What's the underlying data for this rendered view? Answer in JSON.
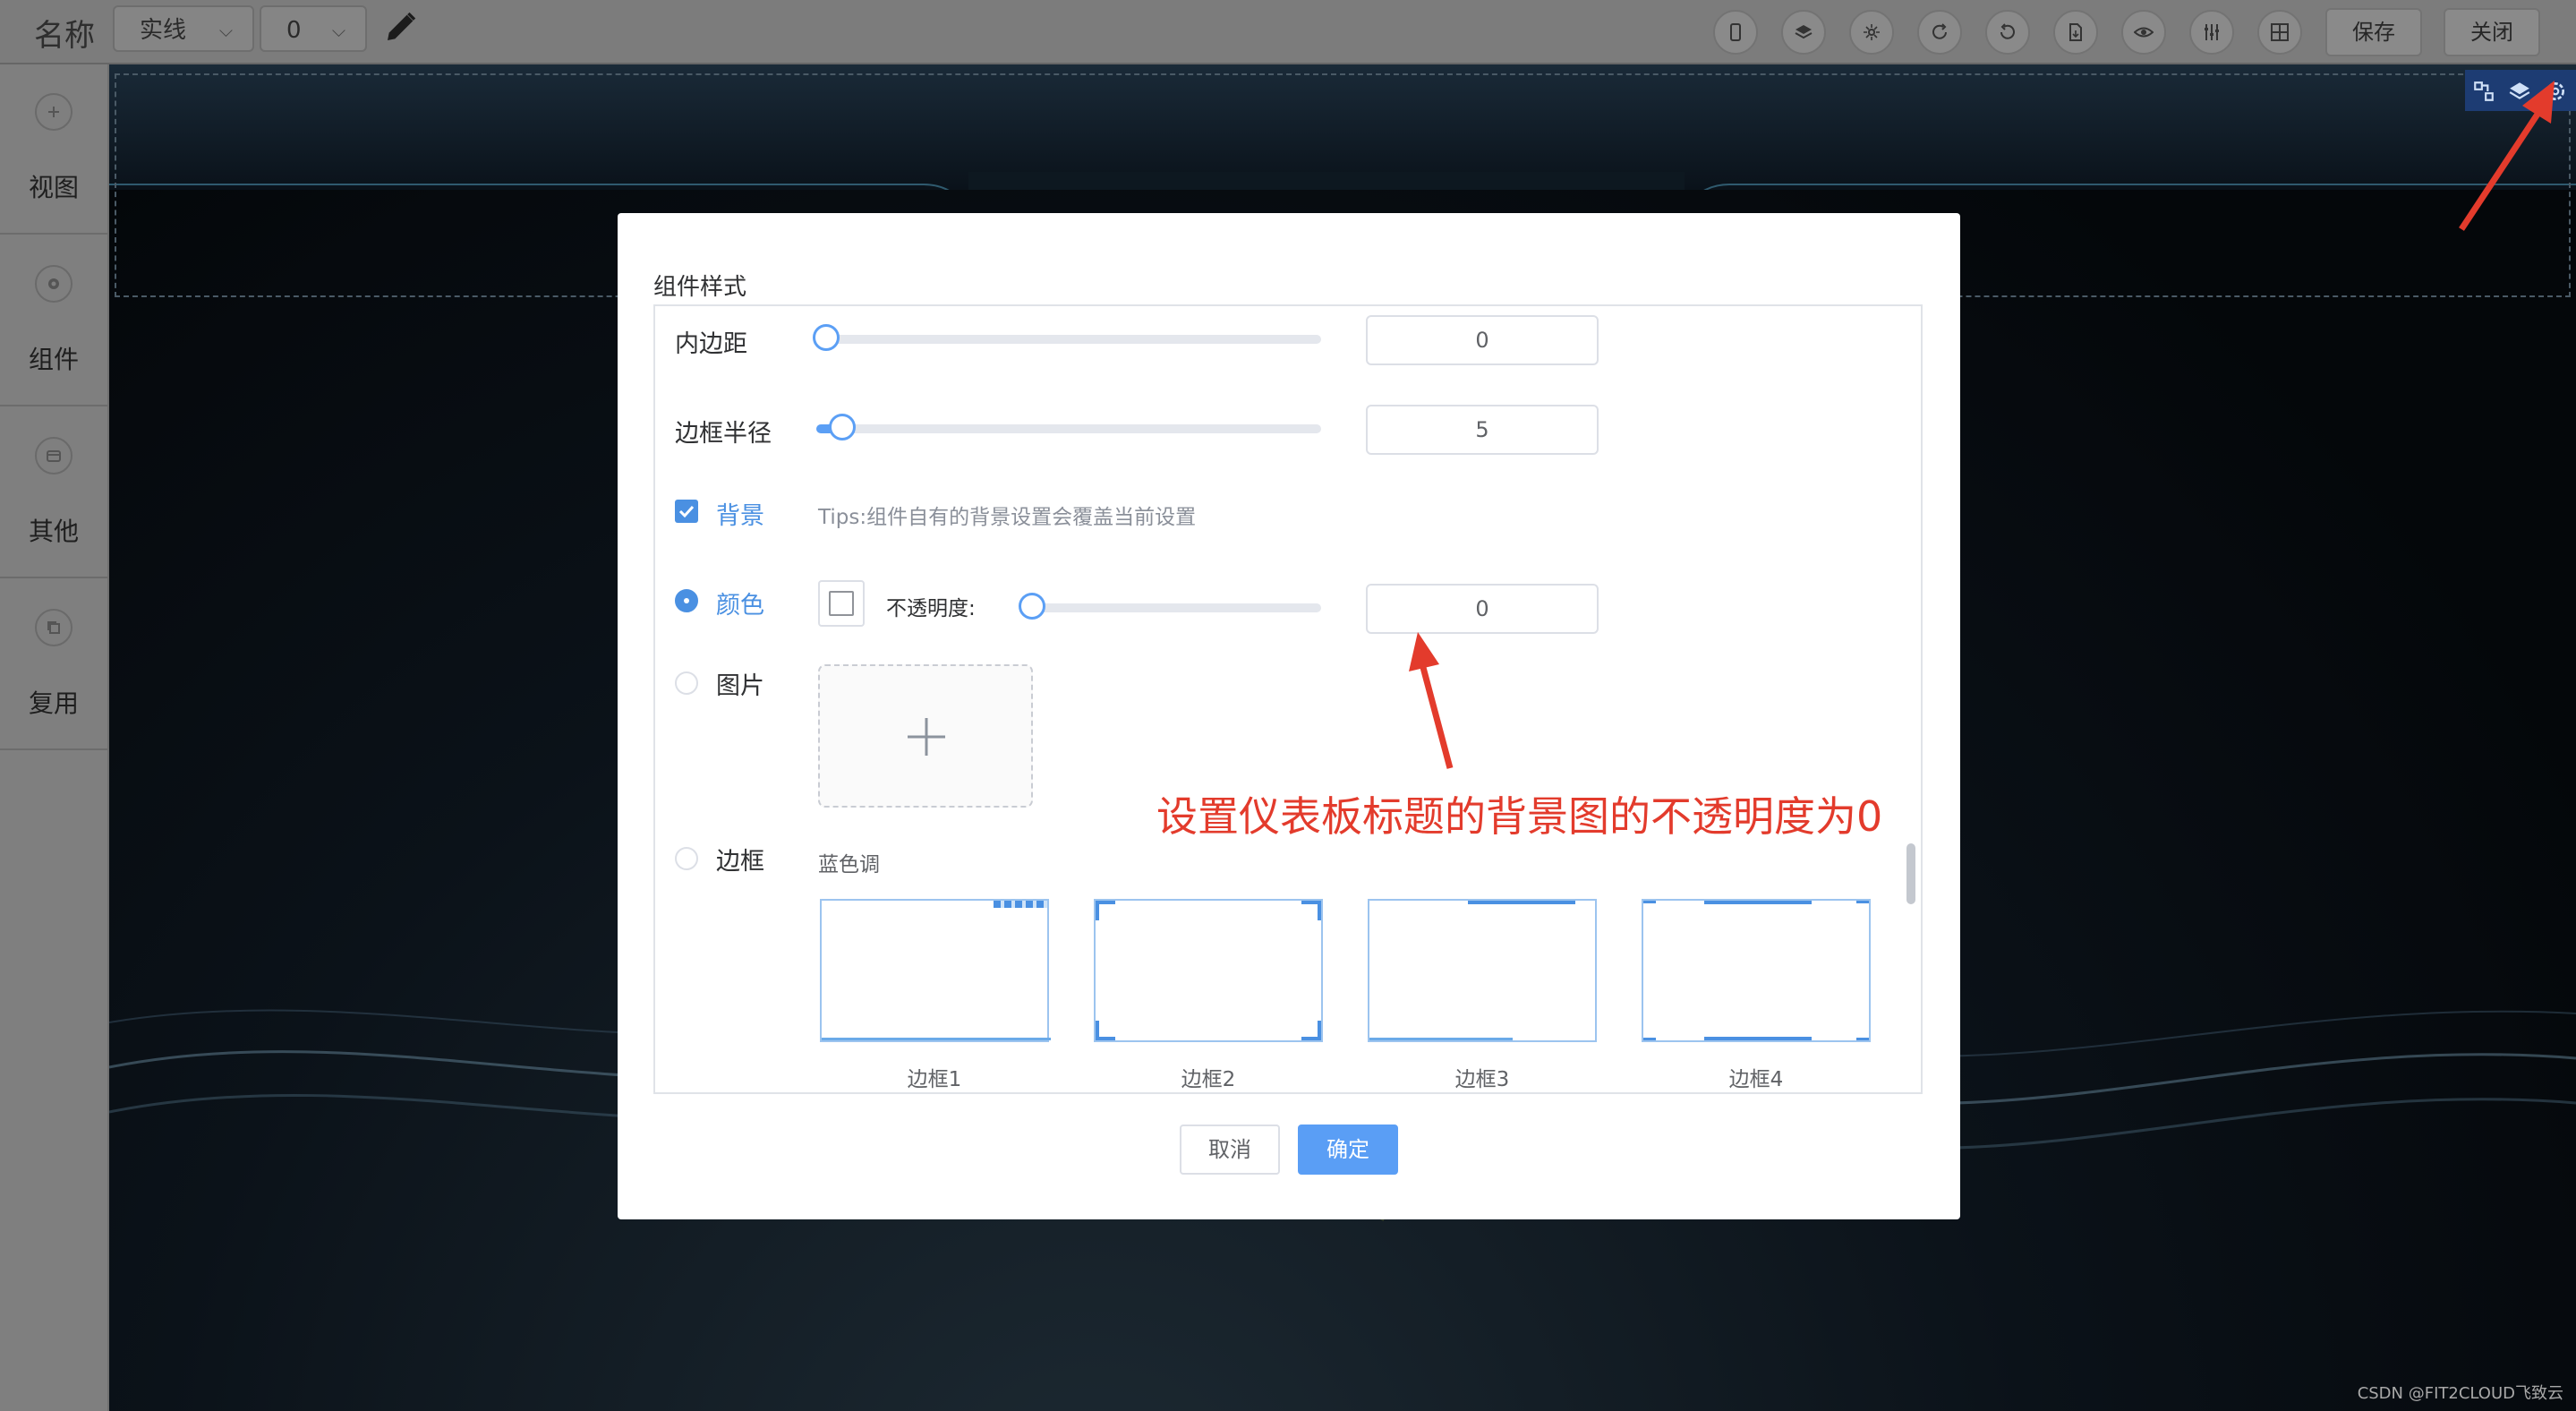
{
  "toolbar": {
    "name_label": "名称",
    "line_style": "实线",
    "line_width": "0",
    "icons": [
      "mobile-icon",
      "layers-icon",
      "magic-icon",
      "refresh-icon",
      "undo-icon",
      "export-icon",
      "preview-icon",
      "settings-sliders-icon",
      "grid-icon"
    ],
    "save_label": "保存",
    "close_label": "关闭"
  },
  "sidebar": {
    "items": [
      {
        "label": "视图",
        "icon": "plus-circle-icon"
      },
      {
        "label": "组件",
        "icon": "gear-icon"
      },
      {
        "label": "其他",
        "icon": "box-icon"
      },
      {
        "label": "复用",
        "icon": "copy-icon"
      }
    ]
  },
  "dialog": {
    "title": "组件样式",
    "padding": {
      "label": "内边距",
      "value": "0",
      "slider_fraction": 0.0
    },
    "radius": {
      "label": "边框半径",
      "value": "5",
      "slider_fraction": 0.05
    },
    "background": {
      "label": "背景",
      "checked": true,
      "tips": "Tips:组件自有的背景设置会覆盖当前设置"
    },
    "color": {
      "label": "颜色",
      "selected": true,
      "opacity_label": "不透明度:",
      "opacity_value": "0",
      "slider_fraction": 0.0
    },
    "image": {
      "label": "图片",
      "selected": false
    },
    "border": {
      "label": "边框",
      "selected": false,
      "group_label": "蓝色调",
      "cards": [
        "边框1",
        "边框2",
        "边框3",
        "边框4"
      ]
    },
    "cancel_label": "取消",
    "confirm_label": "确定"
  },
  "annotation": {
    "text": "设置仪表板标题的背景图的不透明度为0",
    "color": "#e33b2c"
  },
  "watermark": "CSDN @FIT2CLOUD飞致云",
  "colors": {
    "accent": "#4a90e2",
    "primary_button": "#5a9ef5",
    "corner_tools": "#1d3c73"
  }
}
